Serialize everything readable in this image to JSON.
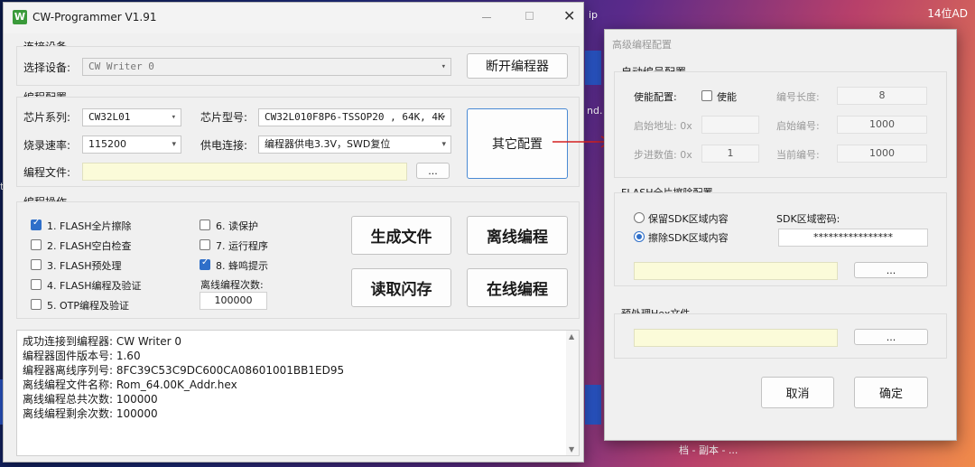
{
  "desktop": {
    "top_right": "14位AD",
    "side1": "ip",
    "side2": "nd.",
    "bottom_file": "档 - 副本 - ...",
    "left_letter": "ta"
  },
  "main_window": {
    "title": "CW-Programmer V1.91",
    "connect": {
      "group_title": "连接设备",
      "select_label": "选择设备:",
      "device_value": "CW Writer 0",
      "disconnect_button": "断开编程器"
    },
    "config": {
      "group_title": "编程配置",
      "chip_series_label": "芯片系列:",
      "chip_series_value": "CW32L01",
      "chip_model_label": "芯片型号:",
      "chip_model_value": "CW32L010F8P6-TSSOP20 , 64K, 4K",
      "baud_label": "烧录速率:",
      "baud_value": "115200",
      "power_label": "供电连接:",
      "power_value": "编程器供电3.3V，SWD复位",
      "file_label": "编程文件:",
      "file_value": "",
      "browse_button": "...",
      "other_config_button": "其它配置"
    },
    "ops": {
      "group_title": "编程操作",
      "options": [
        {
          "label": "1. FLASH全片擦除",
          "checked": true
        },
        {
          "label": "2. FLASH空白检查",
          "checked": false
        },
        {
          "label": "3. FLASH预处理",
          "checked": false
        },
        {
          "label": "4. FLASH编程及验证",
          "checked": false
        },
        {
          "label": "5. OTP编程及验证",
          "checked": false
        },
        {
          "label": "6. 读保护",
          "checked": false
        },
        {
          "label": "7. 运行程序",
          "checked": false
        },
        {
          "label": "8. 蜂鸣提示",
          "checked": true
        }
      ],
      "offline_count_label": "离线编程次数:",
      "offline_count_value": "100000",
      "generate_button": "生成文件",
      "offline_button": "离线编程",
      "read_button": "读取闪存",
      "online_button": "在线编程"
    },
    "log": [
      "成功连接到编程器: CW Writer 0",
      "编程器固件版本号: 1.60",
      "编程器离线序列号: 8FC39C53C9DC600CA08601001BB1ED95",
      "离线编程文件名称: Rom_64.00K_Addr.hex",
      "离线编程总共次数: 100000",
      "离线编程剩余次数: 100000"
    ]
  },
  "adv_window": {
    "title": "高级编程配置",
    "auto_number": {
      "group_title": "自动编号配置",
      "enable_label": "使能配置:",
      "enable_checkbox": "使能",
      "enable_checked": false,
      "length_label": "编号长度:",
      "length_value": "8",
      "start_addr_label": "启始地址: 0x",
      "start_addr_value": "",
      "start_num_label": "启始编号:",
      "start_num_value": "1000",
      "step_label": "步进数值: 0x",
      "step_value": "1",
      "current_label": "当前编号:",
      "current_value": "1000"
    },
    "erase": {
      "group_title": "FLASH全片擦除配置",
      "keep_label": "保留SDK区域内容",
      "erase_label": "擦除SDK区域内容",
      "selected": "erase",
      "sdk_pwd_label": "SDK区域密码:",
      "sdk_pwd_value": "****************",
      "file_value": "",
      "browse_button": "..."
    },
    "prehex": {
      "group_title": "预处理Hex文件",
      "file_value": "",
      "browse_button": "..."
    },
    "cancel_button": "取消",
    "ok_button": "确定"
  },
  "colors": {
    "accent": "#2f6fc9",
    "arrow": "#d42020",
    "file_field": "#fbfbd9"
  }
}
